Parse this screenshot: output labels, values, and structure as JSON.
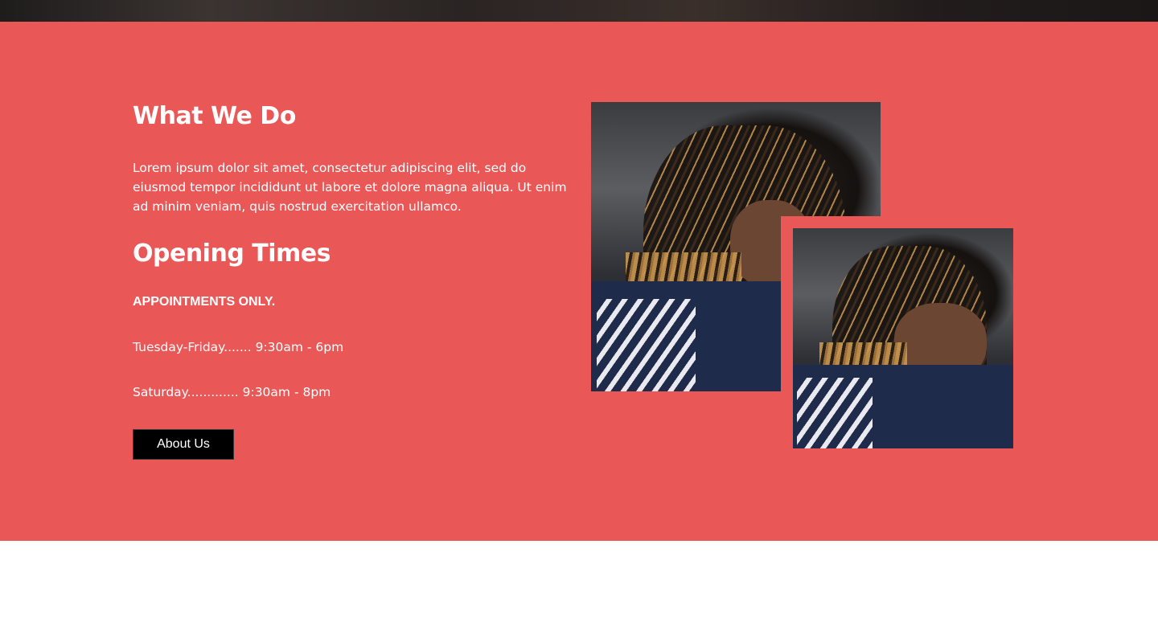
{
  "section": {
    "background_color": "#ea5757",
    "title": "What We Do",
    "description": "Lorem ipsum dolor sit amet, consectetur adipiscing elit, sed do eiusmod tempor incididunt ut labore et dolore magna aliqua. Ut enim ad minim veniam, quis nostrud exercitation ullamco.",
    "opening_title": "Opening Times",
    "appointments_note": "APPOINTMENTS ONLY.",
    "hours": [
      "Tuesday-Friday....... 9:30am - 6pm",
      "Saturday............. 9:30am - 8pm"
    ],
    "button_label": "About Us"
  },
  "images": [
    {
      "icon": "photo-braided-hair-side-profile"
    },
    {
      "icon": "photo-braided-hair-looking-down"
    }
  ]
}
